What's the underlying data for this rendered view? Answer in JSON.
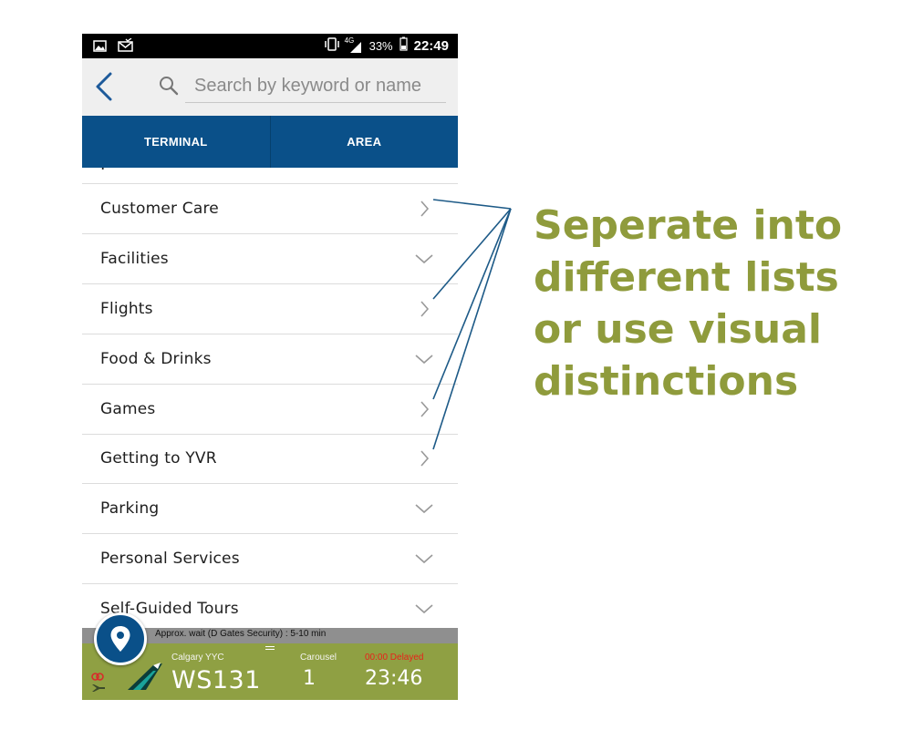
{
  "status_bar": {
    "network": "4G",
    "battery": "33%",
    "time": "22:49"
  },
  "search": {
    "placeholder": "Search by keyword or name"
  },
  "tabs": [
    {
      "label": "TERMINAL"
    },
    {
      "label": "AREA"
    }
  ],
  "list": {
    "items": [
      {
        "label": "Customer Care",
        "icon": "chevron-right-icon"
      },
      {
        "label": "Facilities",
        "icon": "chevron-down-icon"
      },
      {
        "label": "Flights",
        "icon": "chevron-right-icon"
      },
      {
        "label": "Food & Drinks",
        "icon": "chevron-down-icon"
      },
      {
        "label": "Games",
        "icon": "chevron-right-icon"
      },
      {
        "label": "Getting to YVR",
        "icon": "chevron-right-icon"
      },
      {
        "label": "Parking",
        "icon": "chevron-down-icon"
      },
      {
        "label": "Personal Services",
        "icon": "chevron-down-icon"
      },
      {
        "label": "Self-Guided Tours",
        "icon": "chevron-down-icon"
      }
    ]
  },
  "banner": {
    "wait": "Approx. wait (D Gates Security) : 5-10 min",
    "origin": "Calgary YYC",
    "flight": "WS131",
    "carousel_label": "Carousel",
    "carousel_value": "1",
    "status": "00:00 Delayed",
    "time": "23:46"
  },
  "annotation": {
    "lines": [
      "Seperate into",
      "different lists",
      "or use visual",
      "distinctions"
    ]
  },
  "colors": {
    "tab_bar": "#0a5089",
    "flight_bar": "#8fa043",
    "annotation_text": "#8f9b3c",
    "annotation_lines": "#1d5a87",
    "delayed": "#e8211a"
  }
}
